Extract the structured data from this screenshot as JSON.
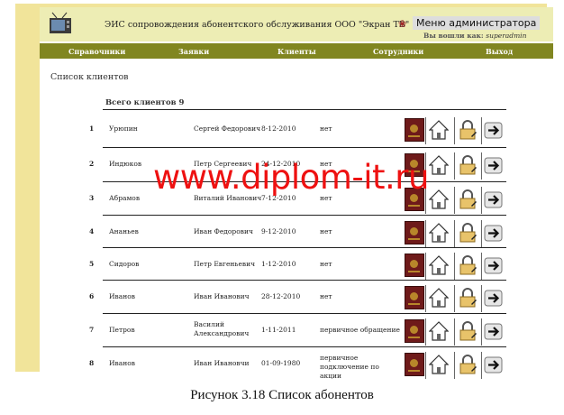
{
  "app": {
    "title": "ЭИС сопровождения абонентского обслуживания ООО \"Экран ТВ\"",
    "admin_menu": "Меню администратора",
    "login_prefix": "Вы вошли как:",
    "login_user": "superadmin"
  },
  "nav": [
    {
      "label": "Справочники"
    },
    {
      "label": "Заявки"
    },
    {
      "label": "Клиенты"
    },
    {
      "label": "Сотрудники"
    },
    {
      "label": "Выход"
    }
  ],
  "page": {
    "heading": "Список клиентов",
    "total_label": "Всего клиентов",
    "total_value": "9"
  },
  "clients": [
    {
      "num": "1",
      "last": "Урюпин",
      "first": "Сергей Федорович",
      "date": "8-12-2010",
      "status": "нет"
    },
    {
      "num": "2",
      "last": "Индюков",
      "first": "Петр Сергеевич",
      "date": "24-12-2010",
      "status": "нет"
    },
    {
      "num": "3",
      "last": "Абрамов",
      "first": "Виталий Иванович",
      "date": "7-12-2010",
      "status": "нет"
    },
    {
      "num": "4",
      "last": "Ананьев",
      "first": "Иван Федорович",
      "date": "9-12-2010",
      "status": "нет"
    },
    {
      "num": "5",
      "last": "Сидоров",
      "first": "Петр Евгеньевич",
      "date": "1-12-2010",
      "status": "нет"
    },
    {
      "num": "6",
      "last": "Иванов",
      "first": "Иван Иванович",
      "date": "28-12-2010",
      "status": "нет"
    },
    {
      "num": "7",
      "last": "Петров",
      "first": "Василий Александрович",
      "date": "1-11-2011",
      "status": "первичное обращение"
    },
    {
      "num": "8",
      "last": "Иванов",
      "first": "Иван Ивановчи",
      "date": "01-09-1980",
      "status": "первичное подключение по акции"
    }
  ],
  "icons": {
    "passport": "passport-icon",
    "home": "home-icon",
    "lock": "lock-icon",
    "arrow": "arrow-right-icon"
  },
  "watermark": "www.diplom-it.ru",
  "caption": "Рисунок 3.18 Список абонентов",
  "colors": {
    "frame": "#f1e49a",
    "header": "#ededb4",
    "navbar": "#818620",
    "watermark": "#ee1111"
  }
}
